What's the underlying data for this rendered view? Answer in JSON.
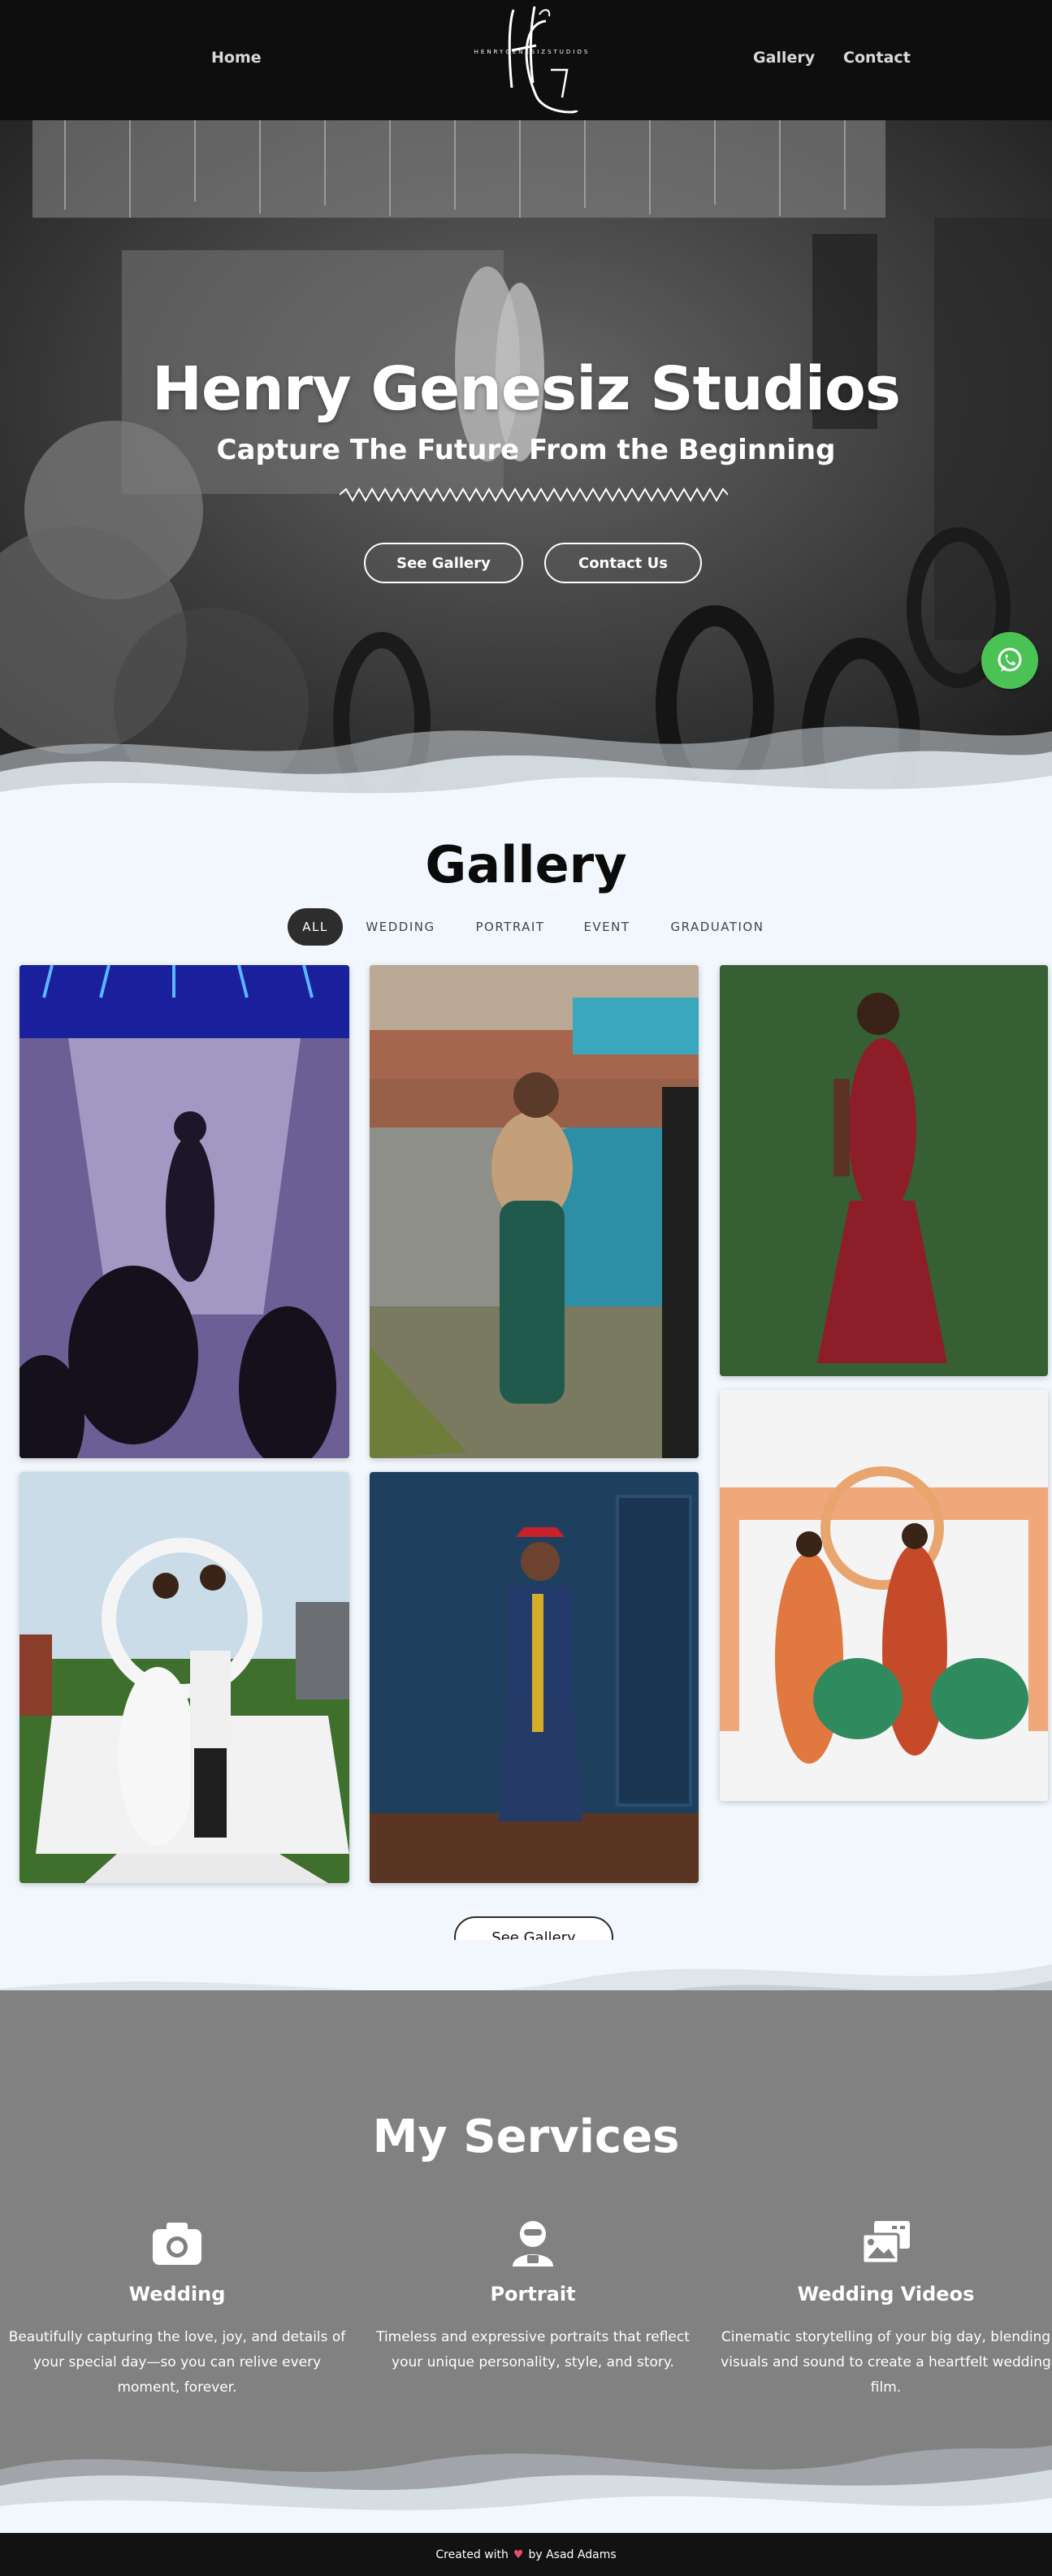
{
  "header": {
    "nav_left": [
      "Home"
    ],
    "nav_right": [
      "Gallery",
      "Contact"
    ],
    "logo_monogram": "HG",
    "logo_text": "HENRYGENESIZSTUDIOS"
  },
  "hero": {
    "title": "Henry Genesiz Studios",
    "subtitle": "Capture The Future From the Beginning",
    "buttons": [
      "See Gallery",
      "Contact Us"
    ]
  },
  "whatsapp": {
    "icon": "whatsapp-icon",
    "color": "#4bc254"
  },
  "gallery": {
    "title": "Gallery",
    "filters": [
      "ALL",
      "WEDDING",
      "PORTRAIT",
      "EVENT",
      "GRADUATION"
    ],
    "active_filter": "ALL",
    "see_gallery": "See Gallery"
  },
  "services": {
    "title": "My Services",
    "items": [
      {
        "icon": "camera-icon",
        "title": "Wedding",
        "description": "Beautifully capturing the love, joy, and details of your special day—so you can relive every moment, forever."
      },
      {
        "icon": "portrait-icon",
        "title": "Portrait",
        "description": "Timeless and expressive portraits that reflect your unique personality, style, and story."
      },
      {
        "icon": "photo-video-icon",
        "title": "Wedding Videos",
        "description": "Cinematic storytelling of your big day, blending visuals and sound to create a heartfelt wedding film."
      }
    ]
  },
  "footer": {
    "prefix": "Created with",
    "heart": "♥",
    "suffix": "by Asad Adams"
  },
  "colors": {
    "header_bg": "#0e0e0e",
    "page_bg": "#f1f7fc",
    "services_bg": "#818181",
    "footer_bg": "#121212",
    "accent_whatsapp": "#4bc254"
  }
}
